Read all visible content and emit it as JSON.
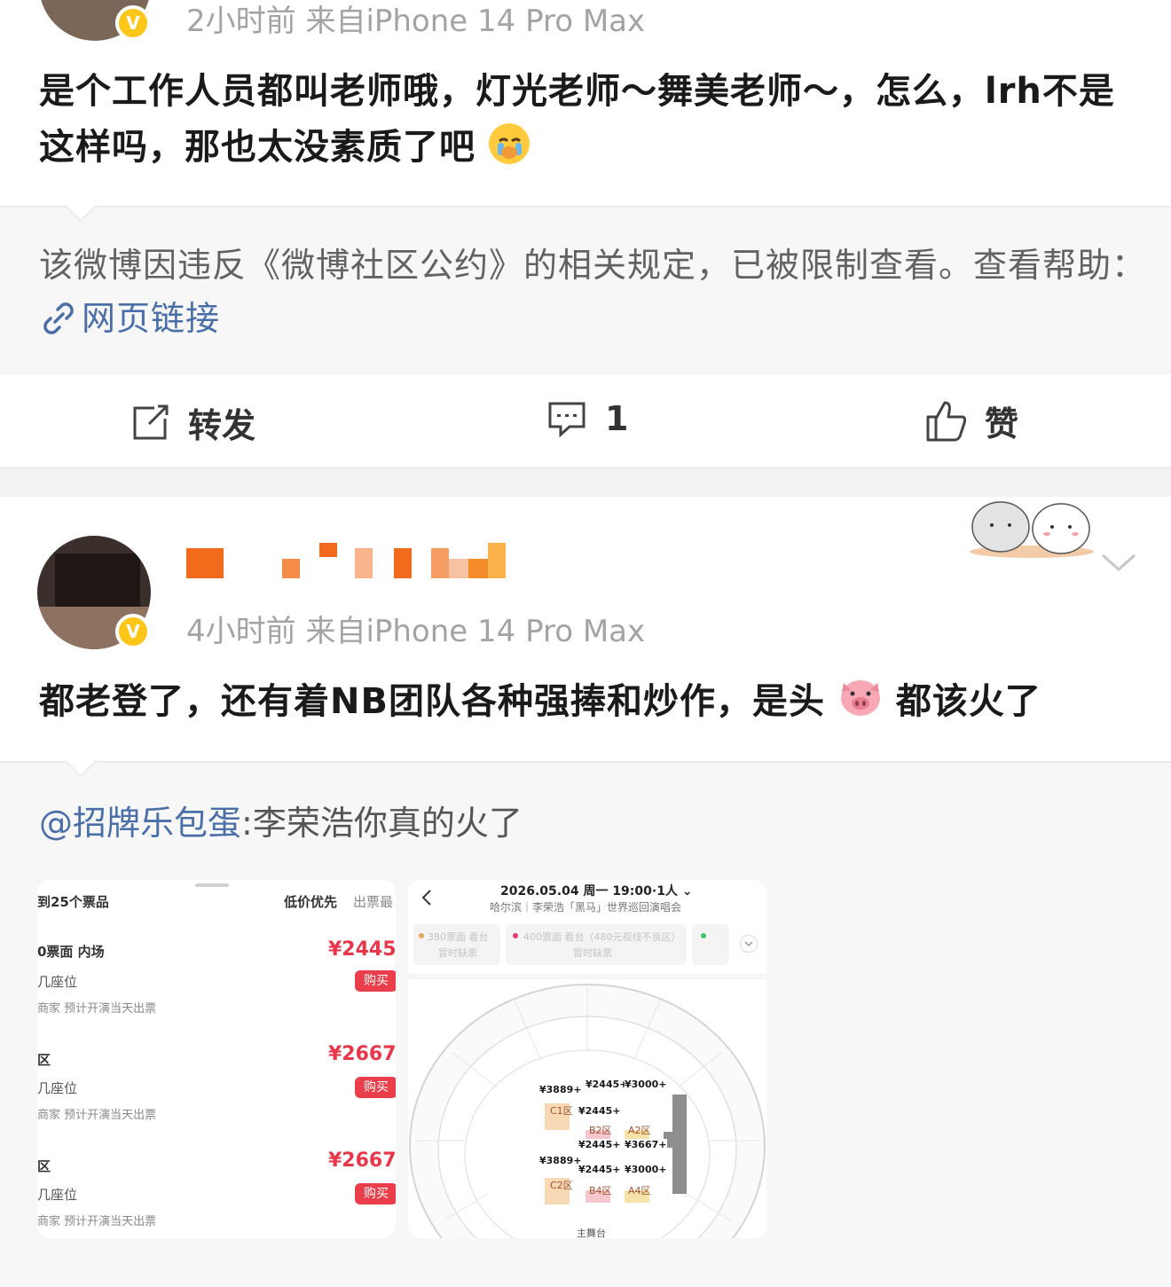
{
  "post1": {
    "meta": "2小时前  来自iPhone 14 Pro Max",
    "verified_mark": "V",
    "text_line1": "是个工作人员都叫老师哦，灯光老师～舞美老师～，怎么，lrh不是",
    "text_line2": "这样吗，那也太没素质了吧",
    "restricted_notice": "该微博因违反《微博社区公约》的相关规定，已被限制查看。查看帮助：",
    "link_icon": "link-icon",
    "link_label": "网页链接"
  },
  "actions": {
    "repost_label": "转发",
    "comment_count": "1",
    "like_label": "赞"
  },
  "post2": {
    "meta": "4小时前  来自iPhone 14 Pro Max",
    "verified_mark": "V",
    "text_before": "都老登了，还有着NB团队各种强捧和炒作，是头",
    "text_after": "都该火了",
    "emoji": "pig-face",
    "repost_mention": "@招牌乐包蛋",
    "repost_text": ":李荣浩你真的火了"
  },
  "ticket_screenshot": {
    "header_left": "到25个票品",
    "sort_low": "低价优先",
    "sort_fast": "出票最",
    "rows": [
      {
        "title": "0票面 内场",
        "seat": "几座位",
        "note": "商家  预计开演当天出票",
        "price": "¥2445/",
        "buy": "购买"
      },
      {
        "title": "区",
        "seat": "几座位",
        "note": "商家  预计开演当天出票",
        "price": "¥2667/",
        "buy": "购买"
      },
      {
        "title": "区",
        "seat": "几座位",
        "note": "商家  预计开演当天出票",
        "price": "¥2667/",
        "buy": "购买"
      }
    ]
  },
  "seat_screenshot": {
    "datetime": "2026.05.04 周一 19:00·1人 ⌄",
    "subtitle": "哈尔滨｜李荣浩「黑马」世界巡回演唱会",
    "tier1": "380票面 看台",
    "tier1_status": "暂时缺票",
    "tier2": "400票面 看台（480元视线不良区）",
    "tier2_status": "暂时缺票",
    "prices": [
      "¥3889+",
      "¥2445+",
      "¥3000+",
      "¥2445+",
      "¥3889+",
      "¥2445+",
      "¥3667+",
      "¥3889+",
      "¥2445+",
      "¥3000+"
    ],
    "zones": [
      "C1区",
      "B2区",
      "A2区",
      "C2区",
      "B4区",
      "A4区"
    ],
    "stage": "主舞台"
  }
}
